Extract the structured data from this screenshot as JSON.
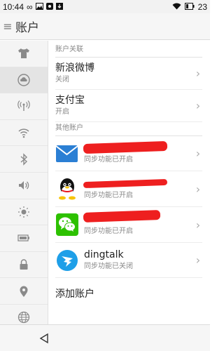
{
  "statusbar": {
    "time": "10:44",
    "battery": "23"
  },
  "topbar": {
    "title": "账户"
  },
  "sidebar": {
    "items": [
      {
        "icon": "tshirt-icon"
      },
      {
        "icon": "cloud-icon",
        "active": true
      },
      {
        "icon": "signal-tower-icon"
      },
      {
        "icon": "wifi-icon"
      },
      {
        "icon": "bluetooth-icon"
      },
      {
        "icon": "volume-icon"
      },
      {
        "icon": "brightness-icon"
      },
      {
        "icon": "battery-icon"
      },
      {
        "icon": "lock-icon"
      },
      {
        "icon": "location-icon"
      },
      {
        "icon": "globe-icon"
      }
    ]
  },
  "content": {
    "section1_header": "账户关联",
    "section2_header": "其他账户",
    "linked": [
      {
        "title": "新浪微博",
        "status": "关闭"
      },
      {
        "title": "支付宝",
        "status": "开启"
      }
    ],
    "accounts": [
      {
        "icon": "mail-icon",
        "status": "同步功能已开启"
      },
      {
        "icon": "qq-icon",
        "status": "同步功能已开启"
      },
      {
        "icon": "wechat-icon",
        "status": "同步功能已开启"
      },
      {
        "icon": "dingtalk-icon",
        "title": "dingtalk",
        "status": "同步功能已关闭"
      }
    ],
    "add_account": "添加账户"
  },
  "colors": {
    "redaction": "#ee1f1f",
    "wechat": "#2dc100",
    "dingtalk": "#1e9fe8",
    "mail": "#2b7fd4"
  }
}
